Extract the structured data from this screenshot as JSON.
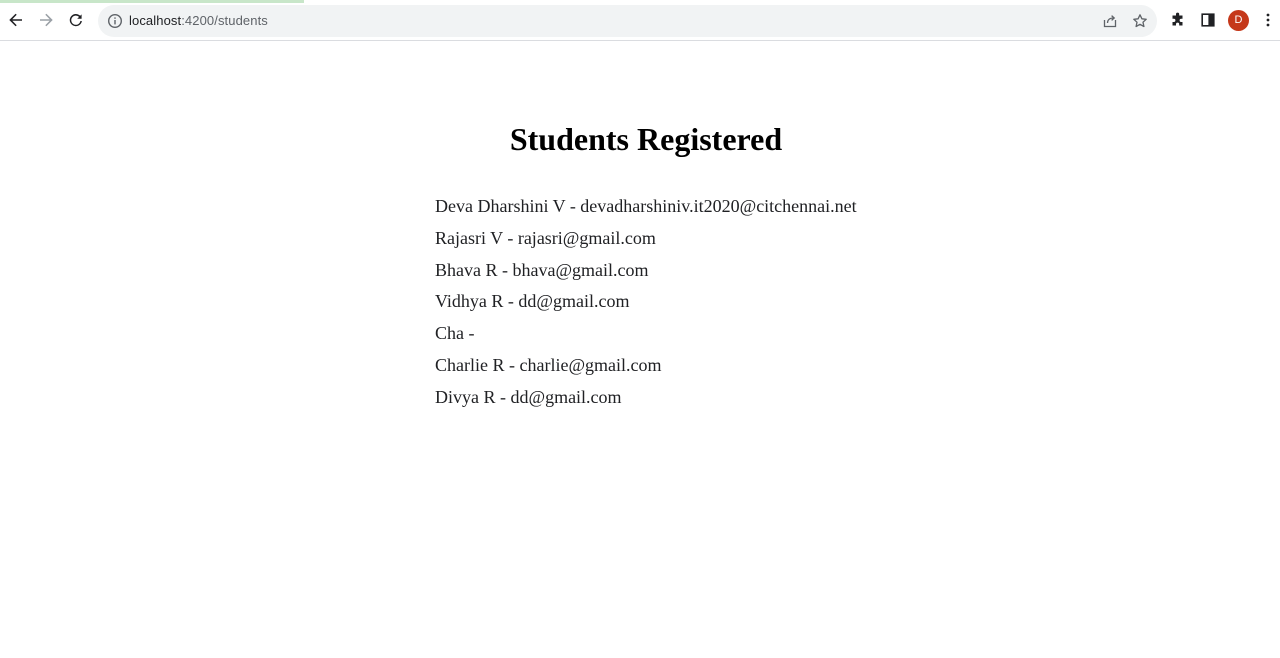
{
  "browser": {
    "url_host": "localhost",
    "url_path": ":4200/students",
    "profile_initial": "D"
  },
  "page": {
    "title": "Students Registered",
    "students": [
      "Deva Dharshini V - devadharshiniv.it2020@citchennai.net",
      "Rajasri V - rajasri@gmail.com",
      "Bhava R - bhava@gmail.com",
      "Vidhya R - dd@gmail.com",
      "Cha -",
      "Charlie R - charlie@gmail.com",
      "Divya R - dd@gmail.com"
    ]
  },
  "colors": {
    "avatar_bg": "#c5381a",
    "omnibox_bg": "#f1f3f4",
    "text": "#202124"
  }
}
